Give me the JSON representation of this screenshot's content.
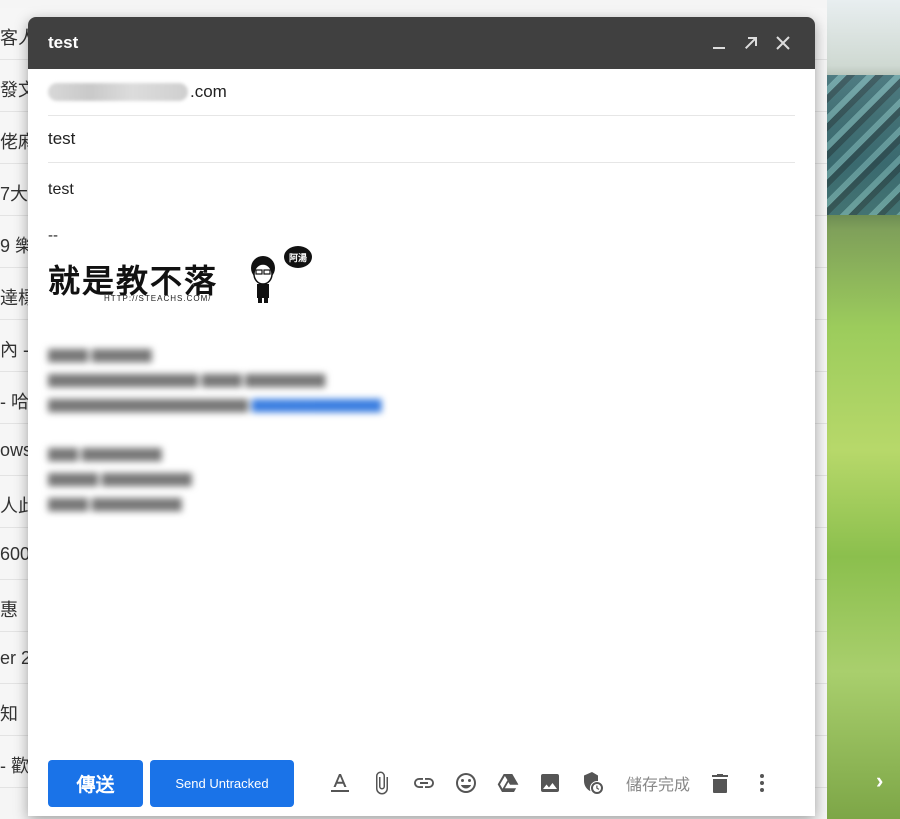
{
  "background": {
    "rows": [
      "客人",
      "發文",
      "佬麻",
      "7大",
      "9 樂",
      "達標",
      "內 - ",
      " - 哈",
      "ows",
      "人此",
      "600",
      "惠",
      "er 2",
      "知",
      "- 歡",
      ""
    ],
    "next_arrow": "›"
  },
  "compose": {
    "title": "test",
    "to_suffix": ".com",
    "subject": "test",
    "body_text": "test",
    "signature": {
      "dash": "--",
      "logo_text": "就是教不落",
      "logo_url": "HTTP://STEACHS.COM/",
      "bubble_text": "阿湯"
    }
  },
  "toolbar": {
    "send_label": "傳送",
    "send_untracked_label": "Send Untracked",
    "save_status": "儲存完成"
  },
  "colors": {
    "titlebar": "#404040",
    "primary_button": "#1a73e8"
  }
}
